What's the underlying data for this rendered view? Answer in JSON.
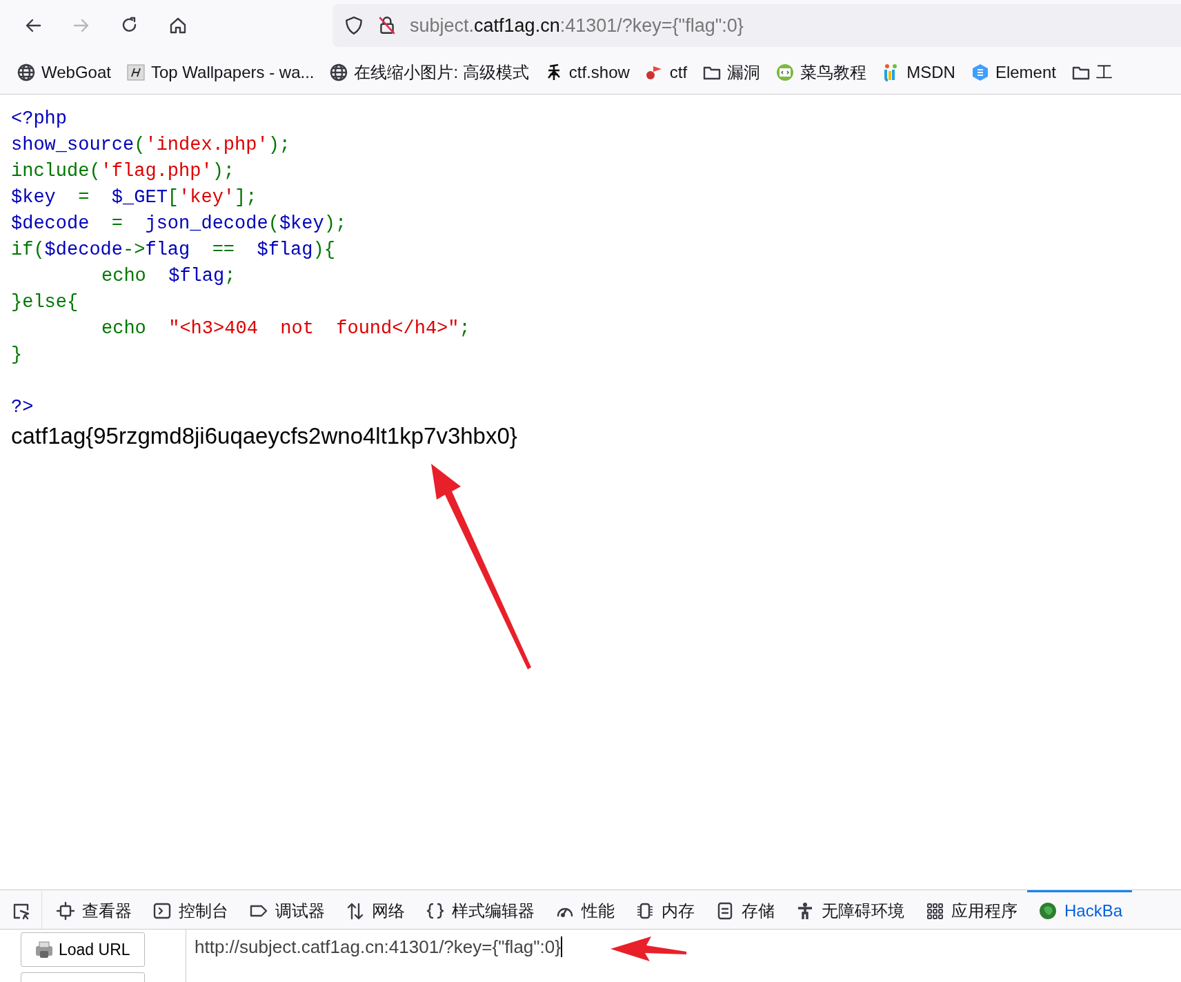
{
  "toolbar": {
    "buttons": [
      {
        "kind": "back",
        "disabled": false
      },
      {
        "kind": "forward",
        "disabled": true
      },
      {
        "kind": "reload",
        "disabled": false
      },
      {
        "kind": "home",
        "disabled": false
      }
    ],
    "url": {
      "subdomain": "subject.",
      "domain": "catf1ag.cn",
      "rest": ":41301/?key={\"flag\":0}"
    }
  },
  "bookmarks": [
    {
      "kind": "globe",
      "label": "WebGoat"
    },
    {
      "kind": "letter",
      "label": "Top Wallpapers - wa..."
    },
    {
      "kind": "globe",
      "label": "在线缩小图片: 高级模式"
    },
    {
      "kind": "glyph",
      "label": "ctf.show"
    },
    {
      "kind": "flagpin",
      "label": "ctf"
    },
    {
      "kind": "folder",
      "label": "漏洞"
    },
    {
      "kind": "code",
      "label": "菜鸟教程"
    },
    {
      "kind": "ui",
      "label": "MSDN"
    },
    {
      "kind": "hexagon",
      "label": "Element"
    },
    {
      "kind": "folder",
      "label": "工"
    }
  ],
  "code": [
    {
      "indented": false,
      "tokens": [
        {
          "kind": "ident",
          "text": "<?php"
        }
      ]
    },
    {
      "indented": false,
      "tokens": [
        {
          "kind": "ident",
          "text": "show_source"
        },
        {
          "kind": "kw",
          "text": "("
        },
        {
          "kind": "str",
          "text": "'index.php'"
        },
        {
          "kind": "kw",
          "text": ");"
        }
      ]
    },
    {
      "indented": false,
      "tokens": [
        {
          "kind": "kw",
          "text": "include("
        },
        {
          "kind": "str",
          "text": "'flag.php'"
        },
        {
          "kind": "kw",
          "text": ");"
        }
      ]
    },
    {
      "indented": false,
      "tokens": [
        {
          "kind": "ident",
          "text": "$key"
        },
        {
          "kind": "kw",
          "text": "  =  "
        },
        {
          "kind": "ident",
          "text": "$_GET"
        },
        {
          "kind": "kw",
          "text": "["
        },
        {
          "kind": "str",
          "text": "'key'"
        },
        {
          "kind": "kw",
          "text": "];"
        }
      ]
    },
    {
      "indented": false,
      "tokens": [
        {
          "kind": "ident",
          "text": "$decode"
        },
        {
          "kind": "kw",
          "text": "  =  "
        },
        {
          "kind": "ident",
          "text": "json_decode"
        },
        {
          "kind": "kw",
          "text": "("
        },
        {
          "kind": "ident",
          "text": "$key"
        },
        {
          "kind": "kw",
          "text": ");"
        }
      ]
    },
    {
      "indented": false,
      "tokens": [
        {
          "kind": "kw",
          "text": "if("
        },
        {
          "kind": "ident",
          "text": "$decode"
        },
        {
          "kind": "kw",
          "text": "->"
        },
        {
          "kind": "ident",
          "text": "flag"
        },
        {
          "kind": "kw",
          "text": "  ==  "
        },
        {
          "kind": "ident",
          "text": "$flag"
        },
        {
          "kind": "kw",
          "text": "){"
        }
      ]
    },
    {
      "indented": true,
      "tokens": [
        {
          "kind": "kw",
          "text": "echo  "
        },
        {
          "kind": "ident",
          "text": "$flag"
        },
        {
          "kind": "kw",
          "text": ";"
        }
      ]
    },
    {
      "indented": false,
      "tokens": [
        {
          "kind": "kw",
          "text": "}else{"
        }
      ]
    },
    {
      "indented": true,
      "tokens": [
        {
          "kind": "kw",
          "text": "echo  "
        },
        {
          "kind": "str",
          "text": "\"<h3>404  not  found</h4>\""
        },
        {
          "kind": "kw",
          "text": ";"
        }
      ]
    },
    {
      "indented": false,
      "tokens": [
        {
          "kind": "kw",
          "text": "}"
        }
      ]
    },
    {
      "kind": "blank"
    },
    {
      "indented": false,
      "tokens": [
        {
          "kind": "ident",
          "text": "?>"
        }
      ]
    }
  ],
  "output": "catf1ag{95rzgmd8ji6uqaeycfs2wno4lt1kp7v3hbx0}",
  "devtools": {
    "tabs": [
      {
        "kind": "picker",
        "selected": false
      },
      {
        "kind": "inspector",
        "label": "查看器",
        "selected": false
      },
      {
        "kind": "console",
        "label": "控制台",
        "selected": false
      },
      {
        "kind": "debugger",
        "label": "调试器",
        "selected": false
      },
      {
        "kind": "network",
        "label": "网络",
        "selected": false
      },
      {
        "kind": "style",
        "label": "样式编辑器",
        "selected": false
      },
      {
        "kind": "perf",
        "label": "性能",
        "selected": false
      },
      {
        "kind": "memory",
        "label": "内存",
        "selected": false
      },
      {
        "kind": "storage",
        "label": "存储",
        "selected": false
      },
      {
        "kind": "a11y",
        "label": "无障碍环境",
        "selected": false
      },
      {
        "kind": "apps",
        "label": "应用程序",
        "selected": false
      },
      {
        "kind": "hackbar",
        "label": "HackBa",
        "selected": true
      }
    ],
    "load_button": "Load URL",
    "url_value": "http://subject.catf1ag.cn:41301/?key={\"flag\":0}"
  }
}
